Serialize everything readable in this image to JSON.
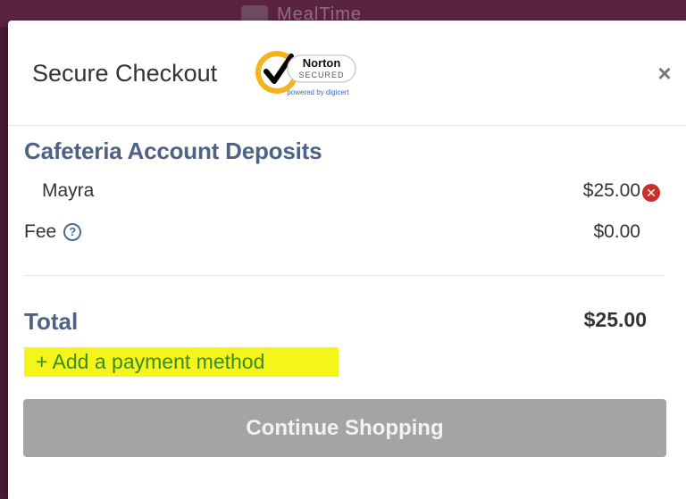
{
  "background": {
    "logo_text": "MealTime"
  },
  "modal": {
    "title": "Secure Checkout",
    "close_glyph": "×",
    "badge": {
      "icon": "norton-check-icon",
      "brand": "Norton",
      "secured": "SECURED",
      "powered_by": "powered by digicert"
    }
  },
  "deposits": {
    "section_title": "Cafeteria Account Deposits",
    "items": [
      {
        "name": "Mayra",
        "amount": "$25.00"
      }
    ],
    "remove_glyph": "✕",
    "fee": {
      "label": "Fee",
      "amount": "$0.00",
      "help_glyph": "?"
    }
  },
  "total": {
    "label": "Total",
    "amount": "$25.00"
  },
  "actions": {
    "add_payment": "+ Add a payment method",
    "continue": "Continue Shopping"
  },
  "colors": {
    "accent_blue": "#4e6285",
    "highlight": "#f5f51a",
    "link_green": "#3a8a2a",
    "remove_red": "#c9302c",
    "button_gray": "#a4a4a4",
    "page_bg": "#5a2340"
  }
}
